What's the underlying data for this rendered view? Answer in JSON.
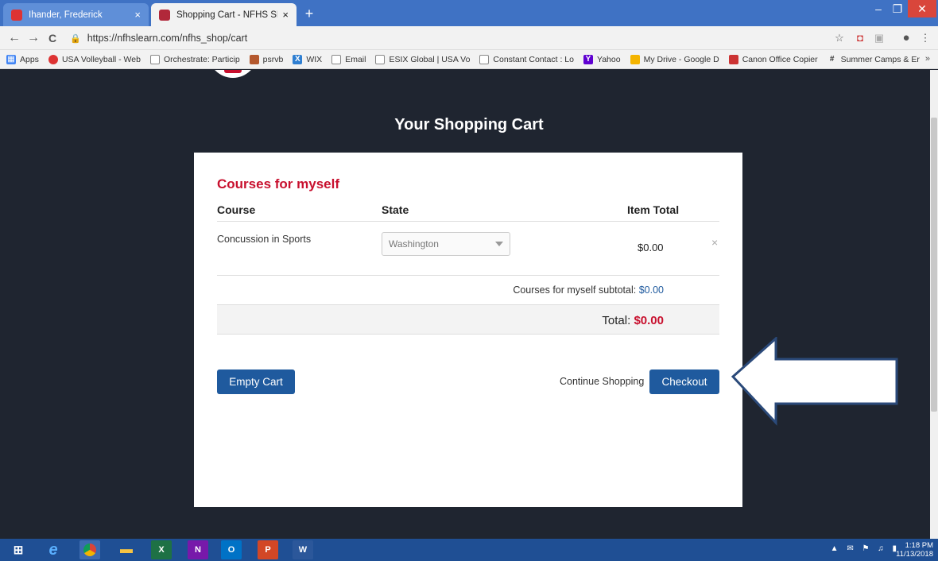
{
  "browser": {
    "tabs": [
      {
        "title": "Ihander, Frederick",
        "active": false
      },
      {
        "title": "Shopping Cart - NFHS SHOP",
        "active": true
      }
    ],
    "close_glyph": "×",
    "new_tab_glyph": "+",
    "window_controls": {
      "minimize": "–",
      "maximize": "❐",
      "close": "✕"
    },
    "nav": {
      "back": "←",
      "forward": "→",
      "reload": "C"
    },
    "url": "https://nfhslearn.com/nfhs_shop/cart",
    "bookmarks": [
      "Apps",
      "USA Volleyball - Web",
      "Orchestrate: Particip",
      "psrvb",
      "WIX",
      "Email",
      "ESIX Global | USA Vo",
      "Constant Contact : Lo",
      "Yahoo",
      "My Drive - Google D",
      "Canon Office Copier",
      "Summer Camps & Er"
    ],
    "bookmarks_more": "»"
  },
  "page": {
    "title": "Your Shopping Cart",
    "section_title": "Courses for myself",
    "columns": {
      "course": "Course",
      "state": "State",
      "item_total": "Item Total"
    },
    "items": [
      {
        "course": "Concussion in Sports",
        "state": "Washington",
        "price": "$0.00"
      }
    ],
    "remove_glyph": "×",
    "subtotal_label": "Courses for myself subtotal:",
    "subtotal_value": "$0.00",
    "total_label": "Total:",
    "total_value": "$0.00",
    "buttons": {
      "empty_cart": "Empty Cart",
      "continue_shopping": "Continue Shopping",
      "checkout": "Checkout"
    }
  },
  "taskbar": {
    "apps": [
      "windows",
      "ie",
      "chrome",
      "explorer",
      "excel",
      "onenote",
      "outlook",
      "powerpoint",
      "word"
    ],
    "time": "1:18 PM",
    "date": "11/13/2018"
  },
  "colors": {
    "accent_red": "#c8102e",
    "button_blue": "#1f5a9e",
    "page_bg": "#1f2530",
    "arrow_stroke": "#2b4a7a"
  }
}
